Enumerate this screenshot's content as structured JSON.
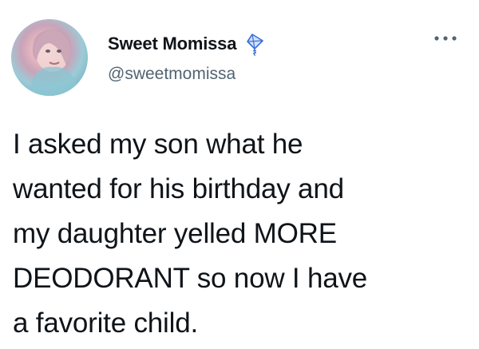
{
  "author": {
    "display_name": "Sweet Momissa",
    "handle": "@sweetmomissa",
    "badge_icon": "kite-icon",
    "avatar_icon": "profile-photo"
  },
  "menu": {
    "icon": "more-horizontal-icon"
  },
  "tweet": {
    "text": "I asked my son what he\nwanted for his birthday and\nmy daughter yelled MORE\nDEODORANT so now I have\na favorite child."
  },
  "colors": {
    "text": "#0f1419",
    "secondary_text": "#536471",
    "background": "#ffffff",
    "kite_blue": "#3b6fd6"
  }
}
